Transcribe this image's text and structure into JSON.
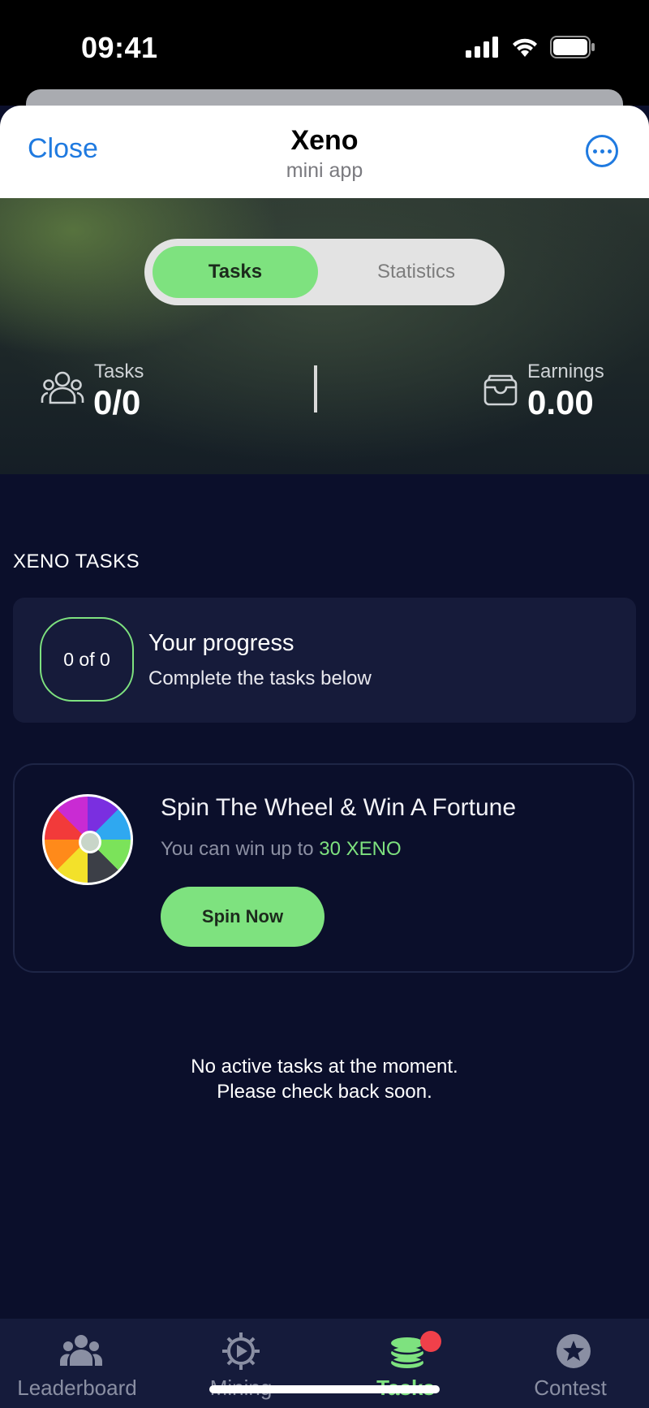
{
  "status_bar": {
    "time": "09:41",
    "icons": [
      "cellular-signal-icon",
      "wifi-icon",
      "battery-icon"
    ]
  },
  "header": {
    "close_label": "Close",
    "title": "Xeno",
    "subtitle": "mini app",
    "more_icon": "more-options-icon"
  },
  "segmented": {
    "tabs": [
      {
        "label": "Tasks",
        "active": true
      },
      {
        "label": "Statistics",
        "active": false
      }
    ]
  },
  "stats": {
    "tasks": {
      "label": "Tasks",
      "value": "0/0",
      "icon": "people-icon"
    },
    "earnings": {
      "label": "Earnings",
      "value": "0.00",
      "icon": "wallet-icon"
    }
  },
  "section": {
    "title": "XENO TASKS"
  },
  "progress": {
    "pill": "0 of 0",
    "title": "Your progress",
    "subtitle": "Complete the tasks below"
  },
  "spin": {
    "title": "Spin The Wheel & Win A Fortune",
    "subtitle_prefix": "You can win up to",
    "amount": "30 XENO",
    "button_label": "Spin Now",
    "icon": "fortune-wheel-icon"
  },
  "empty_state": {
    "line1": "No active tasks at the moment.",
    "line2": "Please check back soon."
  },
  "bottom_nav": {
    "items": [
      {
        "label": "Leaderboard",
        "icon": "users-icon",
        "active": false
      },
      {
        "label": "Mining",
        "icon": "mining-gear-icon",
        "active": false
      },
      {
        "label": "Tasks",
        "icon": "coins-stack-icon",
        "active": true,
        "badge": true
      },
      {
        "label": "Contest",
        "icon": "star-icon",
        "active": false
      }
    ]
  },
  "colors": {
    "accent": "#7ee27f",
    "background": "#0b0f2b",
    "link": "#1f7ae0",
    "badge": "#f0404a"
  }
}
